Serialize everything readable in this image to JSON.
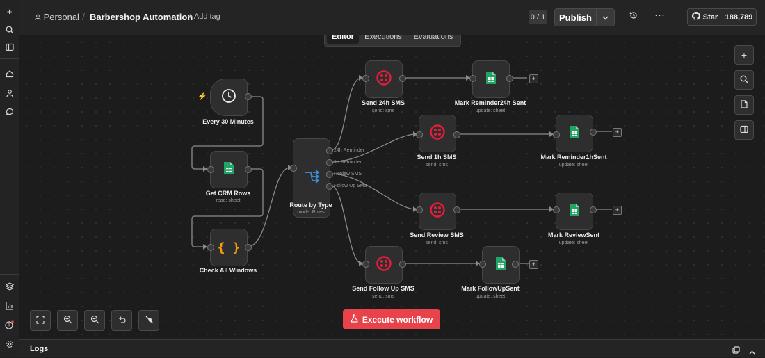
{
  "breadcrumb": {
    "personal": "Personal",
    "slash": "/",
    "workflow": "Barbershop Automation",
    "add_tag": "+ Add tag"
  },
  "header": {
    "counter": "0 / 1",
    "publish": "Publish",
    "star_label": "Star",
    "star_count": "188,789"
  },
  "tabs": [
    "Editor",
    "Executions",
    "Evaluations"
  ],
  "active_tab": "Editor",
  "nodes": {
    "trigger": {
      "label": "Every 30 Minutes"
    },
    "crm": {
      "label": "Get CRM Rows",
      "sub": "read: sheet"
    },
    "check": {
      "label": "Check All Windows"
    },
    "route": {
      "label": "Route by Type",
      "sub": "mode: Rules",
      "outputs": [
        "24h Reminder",
        "1h Reminder",
        "Review SMS",
        "Follow Up SMS"
      ]
    },
    "sms24": {
      "label": "Send 24h SMS",
      "sub": "send: sms"
    },
    "sms1": {
      "label": "Send 1h SMS",
      "sub": "send: sms"
    },
    "smsrev": {
      "label": "Send Review SMS",
      "sub": "send: sms"
    },
    "smsfu": {
      "label": "Send Follow Up SMS",
      "sub": "send: sms"
    },
    "mark24": {
      "label": "Mark Reminder24h Sent",
      "sub": "update: sheet"
    },
    "mark1": {
      "label": "Mark Reminder1hSent",
      "sub": "update: sheet"
    },
    "markrev": {
      "label": "Mark ReviewSent",
      "sub": "update: sheet"
    },
    "markfu": {
      "label": "Mark FollowUpSent",
      "sub": "update: sheet"
    }
  },
  "execute": "Execute workflow",
  "logs": "Logs",
  "colors": {
    "accent": "#e8424a",
    "twilio": "#e31e3b",
    "sheets": "#21a464",
    "code": "#f59e0b",
    "router": "#3b8fd9"
  }
}
